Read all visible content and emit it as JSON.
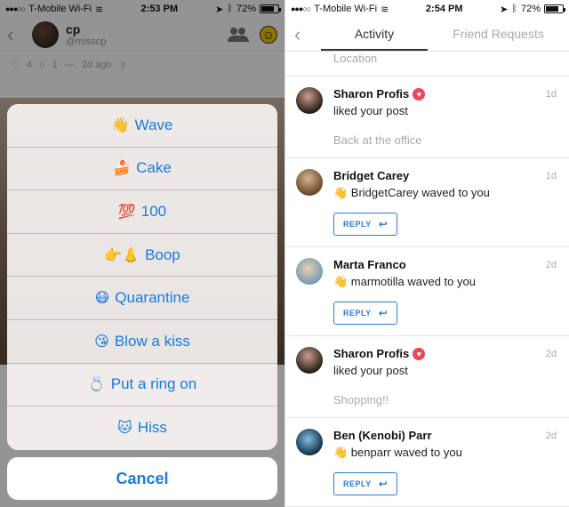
{
  "left": {
    "status": {
      "carrier": "T-Mobile Wi-Fi",
      "time": "2:53 PM",
      "battery": "72%"
    },
    "profile": {
      "username": "cp",
      "handle": "@misscp"
    },
    "post_meta": {
      "likes": "4",
      "comments": "1",
      "time": "2d ago"
    },
    "sheet_items": [
      {
        "emoji": "👋",
        "label": "Wave"
      },
      {
        "emoji": "🍰",
        "label": "Cake"
      },
      {
        "emoji": "💯",
        "label": "100"
      },
      {
        "emoji": "👉👃",
        "label": "Boop"
      },
      {
        "emoji": "😷",
        "label": "Quarantine"
      },
      {
        "emoji": "😘",
        "label": "Blow a kiss"
      },
      {
        "emoji": "💍",
        "label": "Put a ring on"
      },
      {
        "emoji": "🐱",
        "label": "Hiss"
      }
    ],
    "cancel_label": "Cancel"
  },
  "right": {
    "status": {
      "carrier": "T-Mobile Wi-Fi",
      "time": "2:54 PM",
      "battery": "72%"
    },
    "tabs": {
      "activity": "Activity",
      "friend_requests": "Friend Requests"
    },
    "top_strip": "Location",
    "feed": [
      {
        "name": "Sharon Profis",
        "heart": true,
        "line": "liked your post",
        "sub": "Back at the office",
        "time": "1d",
        "reply": false
      },
      {
        "name": "Bridget Carey",
        "heart": false,
        "line": "👋 BridgetCarey waved to you",
        "sub": "",
        "time": "1d",
        "reply": true
      },
      {
        "name": "Marta Franco",
        "heart": false,
        "line": "👋 marmotilla waved to you",
        "sub": "",
        "time": "2d",
        "reply": true
      },
      {
        "name": "Sharon Profis",
        "heart": true,
        "line": "liked your post",
        "sub": "Shopping!!",
        "time": "2d",
        "reply": false
      },
      {
        "name": "Ben (Kenobi) Parr",
        "heart": false,
        "line": "👋 benparr waved to you",
        "sub": "",
        "time": "2d",
        "reply": true
      }
    ],
    "reply_label": "REPLY"
  }
}
